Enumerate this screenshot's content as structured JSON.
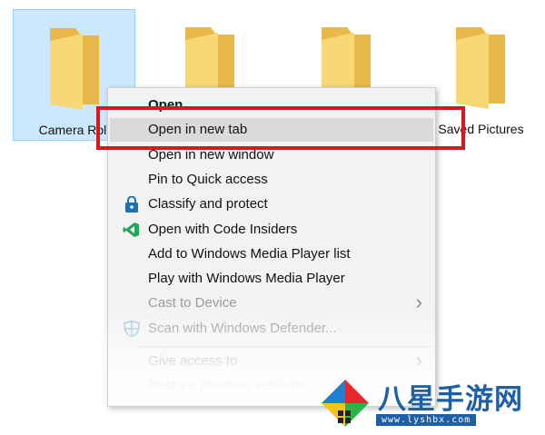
{
  "folders": [
    {
      "label": "Camera Roll",
      "selected": true
    },
    {
      "label": "",
      "selected": false
    },
    {
      "label": "",
      "selected": false
    },
    {
      "label": "Saved Pictures",
      "selected": false
    }
  ],
  "context_menu": {
    "items": [
      {
        "label": "Open",
        "style": "bold"
      },
      {
        "label": "Open in new tab",
        "style": "hover"
      },
      {
        "label": "Open in new window"
      },
      {
        "label": "Pin to Quick access"
      },
      {
        "label": "Classify and protect",
        "icon": "lock-shield-icon"
      },
      {
        "label": "Open with Code Insiders",
        "icon": "code-insiders-icon"
      },
      {
        "label": "Add to Windows Media Player list"
      },
      {
        "label": "Play with Windows Media Player"
      },
      {
        "label": "Cast to Device",
        "style": "disabled",
        "submenu": true
      },
      {
        "label": "Scan with Windows Defender...",
        "style": "disabled",
        "icon": "defender-shield-icon"
      },
      {
        "label": "Give access to",
        "style": "disabled",
        "submenu": true
      },
      {
        "label": "Restore previous versions",
        "style": "disabled"
      }
    ]
  },
  "watermark": {
    "text": "八星手游网",
    "url": "www.lyshbx.com"
  },
  "colors": {
    "folder": "#f8d775",
    "selection": "#cce8ff",
    "highlight": "#e0141b",
    "menu_bg": "#f2f2f2",
    "hover": "#dadada"
  }
}
